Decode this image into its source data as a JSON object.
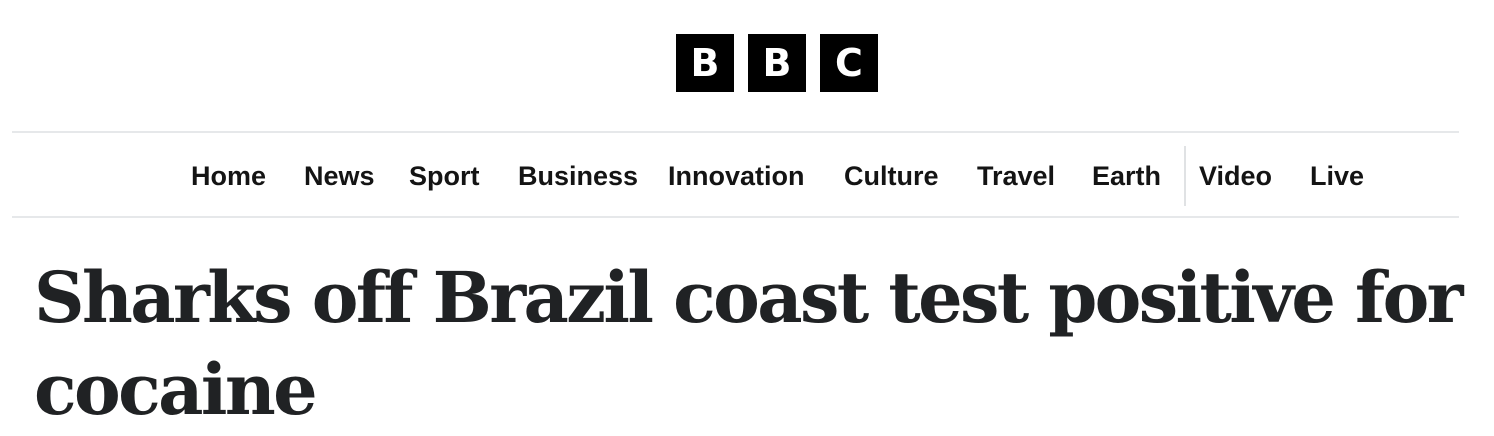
{
  "logo": {
    "letters": [
      "B",
      "B",
      "C"
    ]
  },
  "nav": {
    "items": [
      {
        "label": "Home"
      },
      {
        "label": "News"
      },
      {
        "label": "Sport"
      },
      {
        "label": "Business"
      },
      {
        "label": "Innovation"
      },
      {
        "label": "Culture"
      },
      {
        "label": "Travel"
      },
      {
        "label": "Earth"
      },
      {
        "label": "Video"
      },
      {
        "label": "Live"
      }
    ]
  },
  "article": {
    "headline": "Sharks off Brazil coast test positive for cocaine"
  },
  "colors": {
    "logo_background": "#000000",
    "logo_text": "#ffffff",
    "nav_text": "#141414",
    "headline_text": "#202224",
    "divider": "#e6e8ea"
  }
}
